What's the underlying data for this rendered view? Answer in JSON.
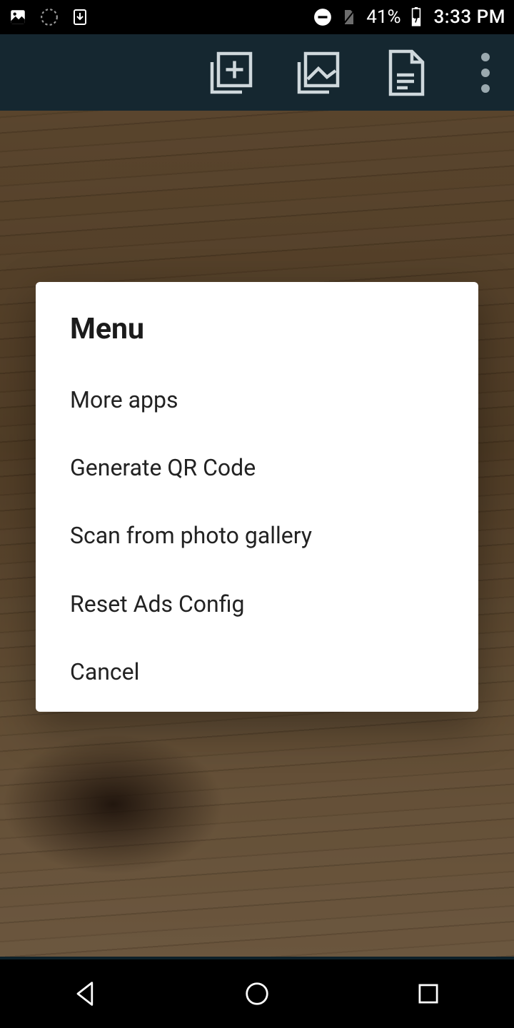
{
  "status": {
    "battery_pct": "41%",
    "time": "3:33 PM",
    "icons_left": [
      "gallery-icon",
      "sync-icon",
      "download-icon"
    ],
    "icons_right": [
      "dnd-icon",
      "no-sim-icon",
      "battery-charging-icon"
    ]
  },
  "appbar": {
    "buttons": [
      {
        "name": "add-to-collection-icon"
      },
      {
        "name": "gallery-icon"
      },
      {
        "name": "document-icon"
      },
      {
        "name": "overflow-icon"
      }
    ]
  },
  "dialog": {
    "title": "Menu",
    "items": [
      {
        "label": "More apps"
      },
      {
        "label": "Generate QR Code"
      },
      {
        "label": "Scan from photo gallery"
      },
      {
        "label": "Reset Ads Config"
      },
      {
        "label": "Cancel"
      }
    ]
  }
}
